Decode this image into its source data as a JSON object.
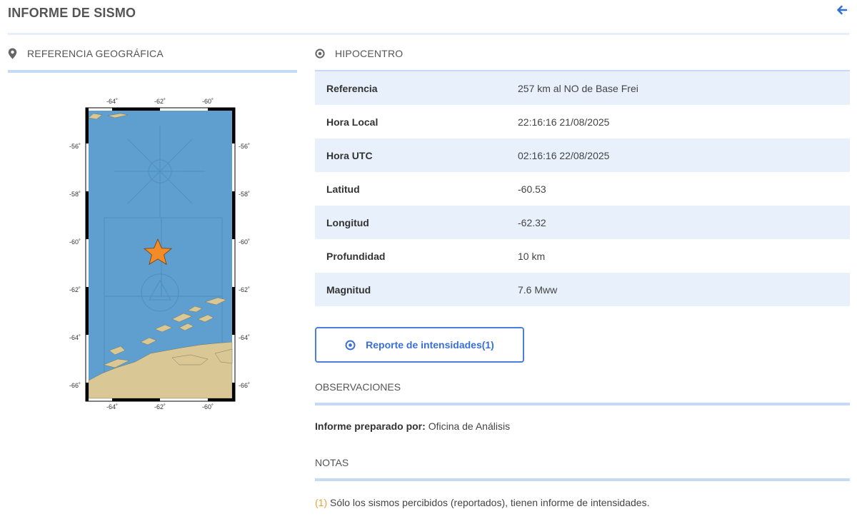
{
  "header": {
    "title": "INFORME DE SISMO",
    "back_icon": "arrow-left-icon",
    "accent": "#2e6fd8"
  },
  "geo": {
    "title": "REFERENCIA GEOGRÁFICA",
    "icon": "map-marker-icon",
    "map": {
      "lon_ticks": [
        "-64˚",
        "-62˚",
        "-60˚"
      ],
      "lat_ticks": [
        "-56˚",
        "-58˚",
        "-60˚",
        "-62˚",
        "-64˚",
        "-66˚"
      ],
      "epicenter_marker_color": "#f28c28",
      "sea_color": "#5f9fd0",
      "land_color": "#d9c795"
    }
  },
  "hypocenter": {
    "title": "HIPOCENTRO",
    "icon": "dot-circle-icon",
    "rows": [
      {
        "label": "Referencia",
        "value": "257 km al NO de Base Frei"
      },
      {
        "label": "Hora Local",
        "value": "22:16:16 21/08/2025"
      },
      {
        "label": "Hora UTC",
        "value": "02:16:16 22/08/2025"
      },
      {
        "label": "Latitud",
        "value": "-60.53"
      },
      {
        "label": "Longitud",
        "value": "-62.32"
      },
      {
        "label": "Profundidad",
        "value": "10 km"
      },
      {
        "label": "Magnitud",
        "value": "7.6 Mww"
      }
    ],
    "row_tint": "#e8f0fc"
  },
  "intensity_button": {
    "label": "Reporte de intensidades(1)",
    "icon": "dot-circle-icon"
  },
  "observations": {
    "title": "OBSERVACIONES",
    "prepared_label": "Informe preparado por:",
    "prepared_value": "Oficina de Análisis"
  },
  "notes": {
    "title": "NOTAS",
    "number": "(1)",
    "text": "Sólo los sismos percibidos (reportados), tienen informe de intensidades."
  }
}
